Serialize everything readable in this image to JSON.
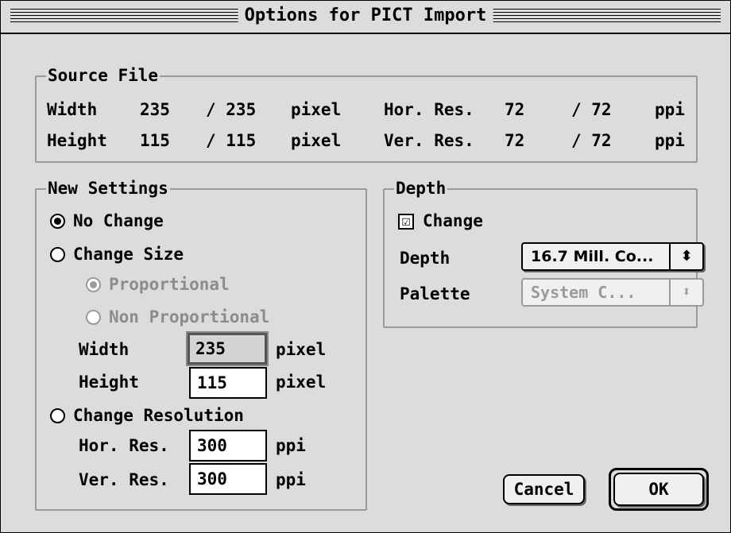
{
  "window": {
    "title": "Options for PICT Import"
  },
  "source_file": {
    "label": "Source File",
    "rows": [
      {
        "label": "Width",
        "value": "235",
        "orig": "/ 235",
        "unit": "pixel",
        "res_label": "Hor. Res.",
        "res_value": "72",
        "res_orig": "/ 72",
        "res_unit": "ppi"
      },
      {
        "label": "Height",
        "value": "115",
        "orig": "/ 115",
        "unit": "pixel",
        "res_label": "Ver. Res.",
        "res_value": "72",
        "res_orig": "/ 72",
        "res_unit": "ppi"
      }
    ]
  },
  "new_settings": {
    "label": "New Settings",
    "no_change": {
      "label": "No Change",
      "selected": true
    },
    "change_size": {
      "label": "Change Size",
      "selected": false
    },
    "proportional": {
      "label": "Proportional",
      "selected": true,
      "enabled": false
    },
    "non_proportional": {
      "label": "Non Proportional",
      "selected": false,
      "enabled": false
    },
    "width": {
      "label": "Width",
      "value": "235",
      "unit": "pixel"
    },
    "height": {
      "label": "Height",
      "value": "115",
      "unit": "pixel"
    },
    "change_resolution": {
      "label": "Change Resolution",
      "selected": false
    },
    "hor_res": {
      "label": "Hor. Res.",
      "value": "300",
      "unit": "ppi"
    },
    "ver_res": {
      "label": "Ver. Res.",
      "value": "300",
      "unit": "ppi"
    }
  },
  "depth": {
    "label": "Depth",
    "change": {
      "label": "Change",
      "checked": true,
      "mark": "☑"
    },
    "depth_select": {
      "label": "Depth",
      "value": "16.7 Mill. Co...",
      "arrow": "⬍"
    },
    "palette_select": {
      "label": "Palette",
      "value": "System C...",
      "arrow": "⬍",
      "enabled": false
    }
  },
  "buttons": {
    "cancel": "Cancel",
    "ok": "OK"
  },
  "icons": {
    "checkbox": "checkmark-icon",
    "popup": "up-down-arrows-icon"
  },
  "colors": {
    "background": "#dcdcdc",
    "disabled_text": "#8c8c8c",
    "group_border": "#9a9a9a"
  }
}
